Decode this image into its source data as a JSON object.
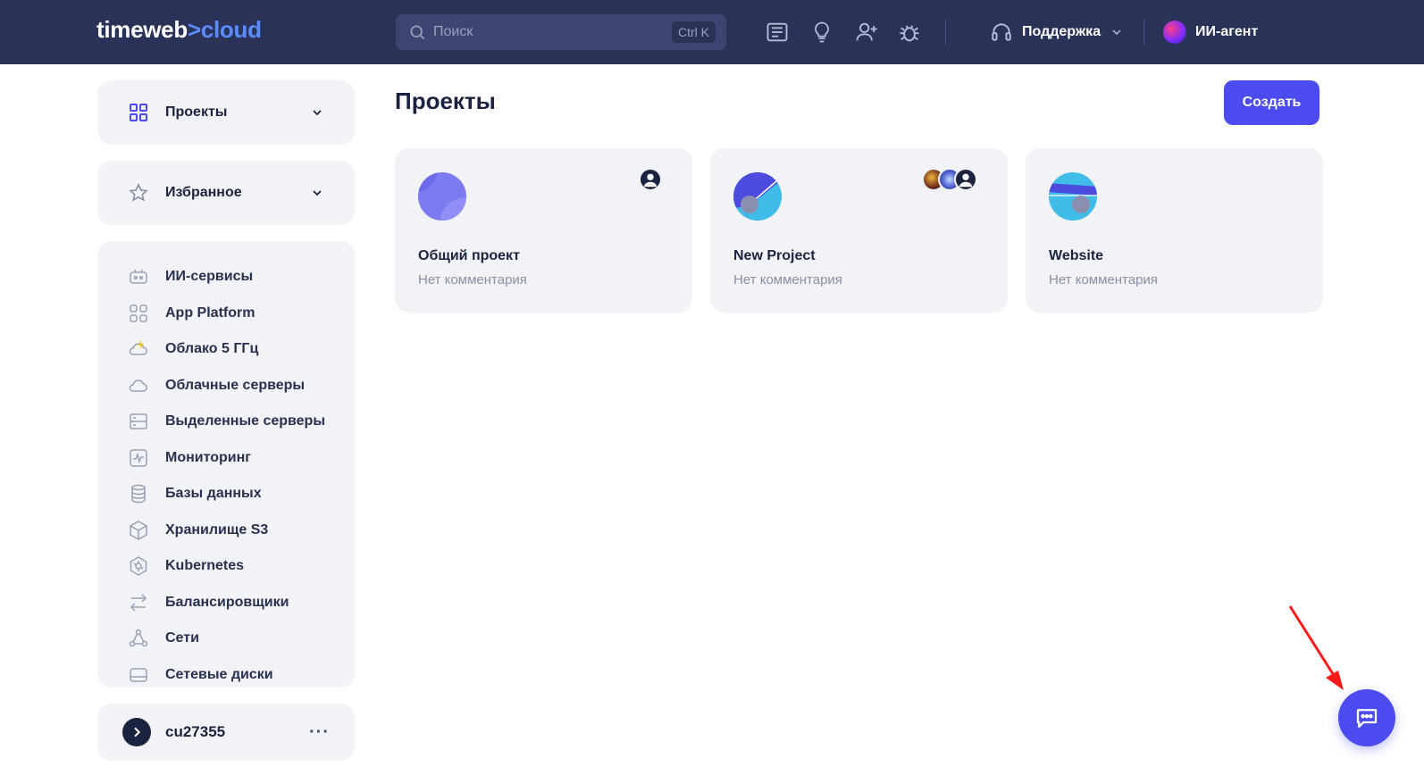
{
  "header": {
    "logo_left": "timeweb",
    "logo_sep": ">",
    "logo_right": "cloud",
    "search_placeholder": "Поиск",
    "search_shortcut": "Ctrl K",
    "support_label": "Поддержка",
    "agent_label": "ИИ-агент"
  },
  "sidebar": {
    "projects_label": "Проекты",
    "favorites_label": "Избранное",
    "items": [
      {
        "label": "ИИ-сервисы",
        "icon": "robot-icon"
      },
      {
        "label": "App Platform",
        "icon": "grid-icon"
      },
      {
        "label": "Облако 5 ГГц",
        "icon": "cloud-bolt-icon"
      },
      {
        "label": "Облачные серверы",
        "icon": "cloud-icon"
      },
      {
        "label": "Выделенные серверы",
        "icon": "server-icon"
      },
      {
        "label": "Мониторинг",
        "icon": "monitoring-icon"
      },
      {
        "label": "Базы данных",
        "icon": "database-icon"
      },
      {
        "label": "Хранилище S3",
        "icon": "cube-icon"
      },
      {
        "label": "Kubernetes",
        "icon": "kubernetes-icon"
      },
      {
        "label": "Балансировщики",
        "icon": "arrows-icon"
      },
      {
        "label": "Сети",
        "icon": "network-icon"
      },
      {
        "label": "Сетевые диски",
        "icon": "disk-icon"
      }
    ],
    "user": {
      "name": "cu27355",
      "more": "···"
    }
  },
  "main": {
    "title": "Проекты",
    "create_label": "Создать",
    "projects": [
      {
        "name": "Общий проект",
        "comment": "Нет комментария"
      },
      {
        "name": "New Project",
        "comment": "Нет комментария"
      },
      {
        "name": "Website",
        "comment": "Нет комментария"
      }
    ]
  },
  "colors": {
    "header_bg": "#2b3258",
    "accent": "#4b4bf0",
    "card_bg": "#f2f3f6",
    "logo_accent": "#5b8cff"
  }
}
